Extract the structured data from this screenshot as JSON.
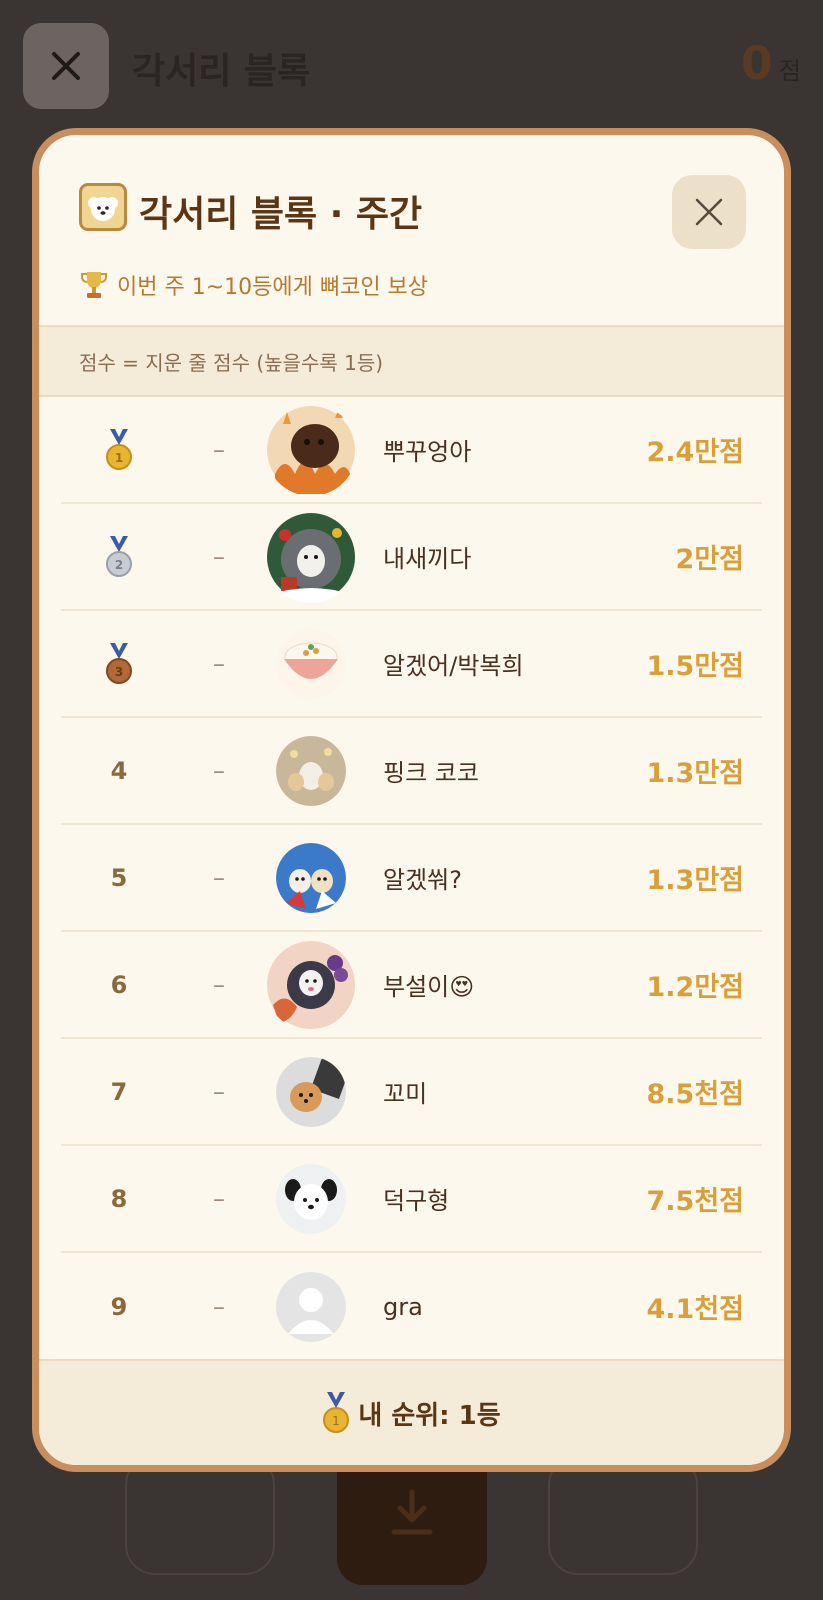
{
  "game": {
    "title": "각서리 블록",
    "score": "0",
    "score_unit": "점"
  },
  "modal": {
    "title": "각서리 블록 · 주간",
    "reward_text": "이번 주 1~10등에게 뼈코인 보상",
    "info_text": "점수 = 지운 줄 점수 (높을수록 1등)",
    "my_rank_text": "내 순위: 1등"
  },
  "leaderboard": [
    {
      "rank": "1",
      "medal": "gold",
      "change": "–",
      "name": "뿌꾸엉아",
      "score": "2.4만점",
      "avatar": "dog-campfire-frame"
    },
    {
      "rank": "2",
      "medal": "silver",
      "change": "–",
      "name": "내새끼다",
      "score": "2만점",
      "avatar": "dog-christmas-frame"
    },
    {
      "rank": "3",
      "medal": "bronze",
      "change": "–",
      "name": "알겠어/박복희",
      "score": "1.5만점",
      "avatar": "rice-bowl"
    },
    {
      "rank": "4",
      "medal": "",
      "change": "–",
      "name": "핑크 코코",
      "score": "1.3만점",
      "avatar": "dogs-photo"
    },
    {
      "rank": "5",
      "medal": "",
      "change": "–",
      "name": "알겠쒀?",
      "score": "1.3만점",
      "avatar": "two-dogs-blue"
    },
    {
      "rank": "6",
      "medal": "",
      "change": "–",
      "name": "부설이😍",
      "score": "1.2만점",
      "avatar": "dog-grapes-frame"
    },
    {
      "rank": "7",
      "medal": "",
      "change": "–",
      "name": "꼬미",
      "score": "8.5천점",
      "avatar": "pomeranian-photo"
    },
    {
      "rank": "8",
      "medal": "",
      "change": "–",
      "name": "덕구형",
      "score": "7.5천점",
      "avatar": "white-dog-photo"
    },
    {
      "rank": "9",
      "medal": "",
      "change": "–",
      "name": "gra",
      "score": "4.1천점",
      "avatar": "default-avatar"
    }
  ],
  "colors": {
    "accent": "#d9a03a",
    "frame": "#c98e5e",
    "gold": "#e8b530",
    "silver": "#b8bcc4",
    "bronze": "#b06a3a"
  }
}
